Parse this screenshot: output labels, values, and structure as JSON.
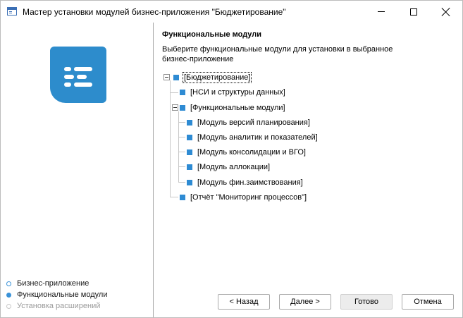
{
  "window": {
    "title": "Мастер установки модулей бизнес-приложения \"Бюджетирование\"",
    "icon": "wizard-window-icon"
  },
  "colors": {
    "accent": "#2d8ccc",
    "checkbox": "#2e8bd3",
    "step_inactive": "#c8c8c8"
  },
  "steps": [
    {
      "label": "Бизнес-приложение",
      "state": "done"
    },
    {
      "label": "Функциональные модули",
      "state": "active"
    },
    {
      "label": "Установка расширений",
      "state": "disabled"
    }
  ],
  "section": {
    "title": "Функциональные модули",
    "description": "Выберите функциональные модули для установки в выбранное бизнес-приложение"
  },
  "tree": {
    "root": "[Бюджетирование]",
    "nsi": "[НСИ и структуры данных]",
    "functional": "[Функциональные модули]",
    "modules": [
      "[Модуль версий планирования]",
      "[Модуль аналитик и показателей]",
      "[Модуль консолидации и ВГО]",
      "[Модуль аллокации]",
      "[Модуль фин.заимствования]"
    ],
    "report": "[Отчёт \"Мониторинг процессов\"]"
  },
  "buttons": {
    "back": "< Назад",
    "next": "Далее >",
    "finish": "Готово",
    "cancel": "Отмена"
  }
}
